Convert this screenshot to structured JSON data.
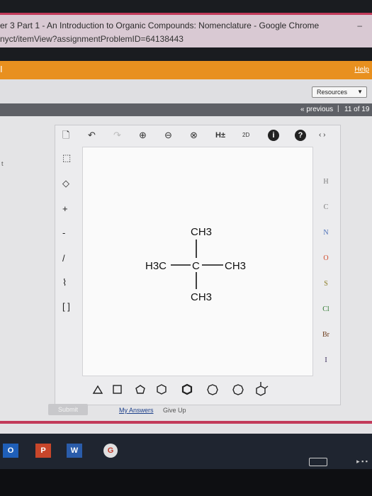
{
  "window": {
    "title": "er 3 Part 1 - An Introduction to Organic Compounds: Nomenclature - Google Chrome",
    "url": "nyct/itemView?assignmentProblemID=64138443",
    "minimize": "–"
  },
  "topbar": {
    "left_glyph": "I",
    "help": "Help"
  },
  "resources": {
    "label": "Resources",
    "arrow": "▼"
  },
  "navigation": {
    "previous": "« previous",
    "separator": "|",
    "page": "11 of 19"
  },
  "side_mark": "t",
  "toolbar": {
    "new": "🗋",
    "undo": "↶",
    "redo": "↷",
    "zoom_in": "⊕",
    "zoom_out": "⊖",
    "clear": "⊗",
    "h_toggle": "H±",
    "view_2d": "2D",
    "info": "i",
    "help": "?",
    "collapse": "‹ ›"
  },
  "left_tools": {
    "select": "⬚",
    "erase": "◇",
    "charge_plus": "+",
    "charge_minus": "-",
    "single_bond": "/",
    "chain": "⌇",
    "bracket": "[ ]"
  },
  "molecule": {
    "top_group": "CH3",
    "left_group": "H3C",
    "center": "C",
    "right_group": "CH3",
    "bottom_group": "CH3"
  },
  "elements": [
    {
      "symbol": "H",
      "color": "#7a7a7a"
    },
    {
      "symbol": "C",
      "color": "#7a7a7a"
    },
    {
      "symbol": "N",
      "color": "#4a6fb8"
    },
    {
      "symbol": "O",
      "color": "#d24a2a"
    },
    {
      "symbol": "S",
      "color": "#8a7a20"
    },
    {
      "symbol": "Cl",
      "color": "#2f7a2f"
    },
    {
      "symbol": "Br",
      "color": "#6b3a1a"
    },
    {
      "symbol": "I",
      "color": "#3a2a5a"
    }
  ],
  "actions": {
    "submit": "Submit",
    "my_answers": "My Answers",
    "give_up": "Give Up"
  },
  "taskbar": {
    "outlook": "O",
    "powerpoint": "P",
    "word": "W",
    "chrome": "G"
  },
  "colors": {
    "accent": "#e8901f",
    "brand_pink": "#c23a5a",
    "link": "#1c3f8a"
  }
}
